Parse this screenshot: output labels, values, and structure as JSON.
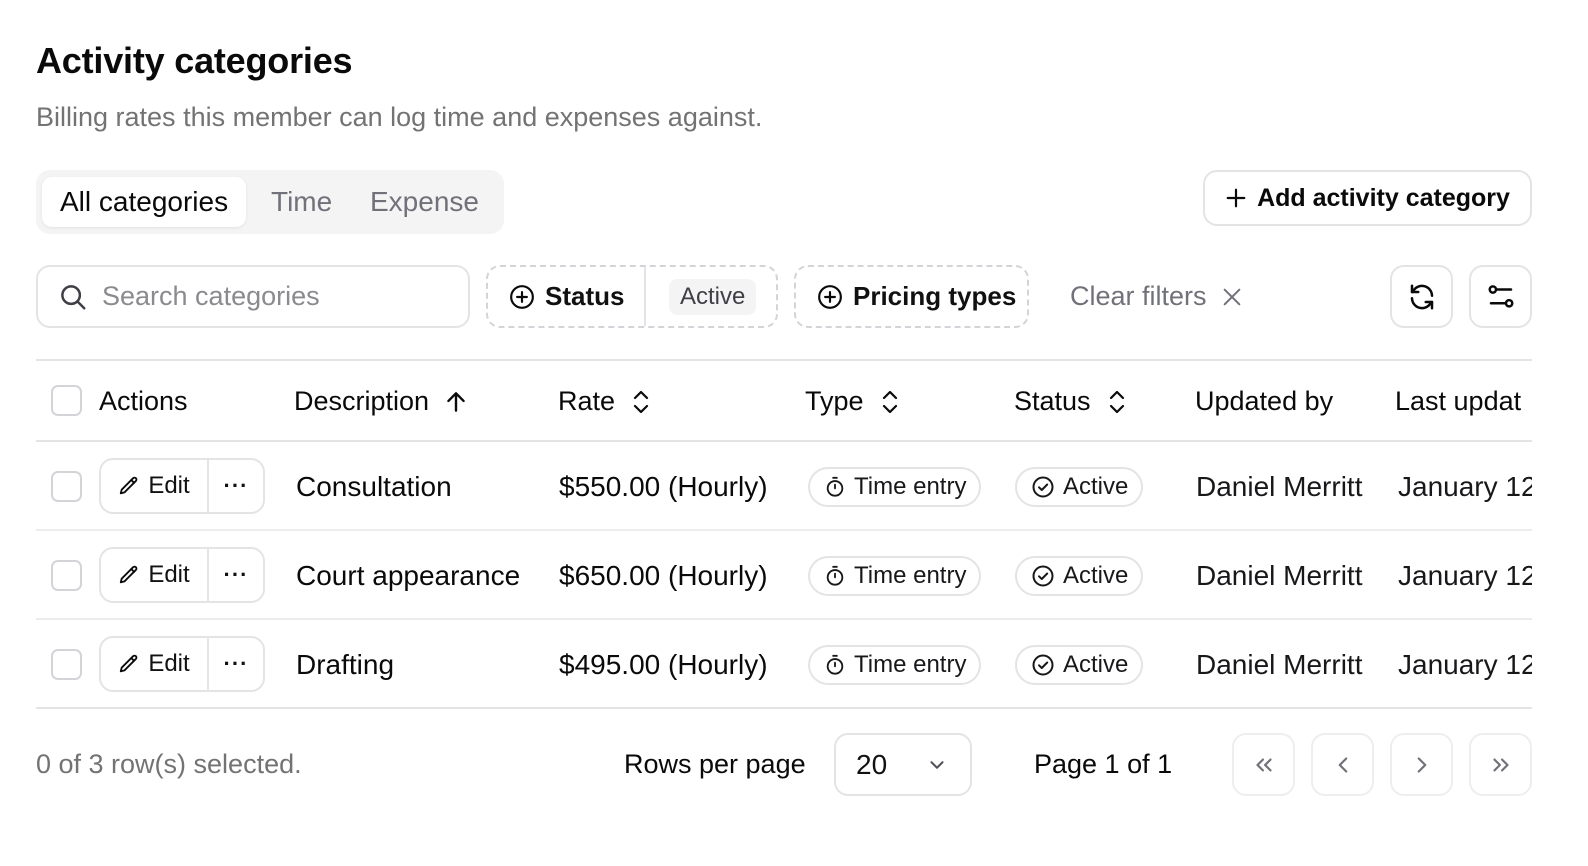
{
  "header": {
    "title": "Activity categories",
    "subtitle": "Billing rates this member can log time and expenses against."
  },
  "tabs": [
    {
      "label": "All categories",
      "active": true
    },
    {
      "label": "Time",
      "active": false
    },
    {
      "label": "Expense",
      "active": false
    }
  ],
  "add_button_label": "Add activity category",
  "toolbar": {
    "search_placeholder": "Search categories",
    "status_filter_label": "Status",
    "status_filter_value": "Active",
    "pricing_filter_label": "Pricing types",
    "clear_filters_label": "Clear filters"
  },
  "table": {
    "columns": [
      {
        "label": "Actions",
        "sort": "none"
      },
      {
        "label": "Description",
        "sort": "asc"
      },
      {
        "label": "Rate",
        "sort": "sortable"
      },
      {
        "label": "Type",
        "sort": "sortable"
      },
      {
        "label": "Status",
        "sort": "sortable"
      },
      {
        "label": "Updated by",
        "sort": "none"
      },
      {
        "label": "Last updat",
        "sort": "none"
      }
    ],
    "edit_label": "Edit",
    "more_label": "···",
    "rows": [
      {
        "description": "Consultation",
        "rate": "$550.00 (Hourly)",
        "type": "Time entry",
        "status": "Active",
        "updated_by": "Daniel Merritt",
        "last_updated": "January 12"
      },
      {
        "description": "Court appearance",
        "rate": "$650.00 (Hourly)",
        "type": "Time entry",
        "status": "Active",
        "updated_by": "Daniel Merritt",
        "last_updated": "January 12"
      },
      {
        "description": "Drafting",
        "rate": "$495.00 (Hourly)",
        "type": "Time entry",
        "status": "Active",
        "updated_by": "Daniel Merritt",
        "last_updated": "January 12"
      }
    ]
  },
  "footer": {
    "selection_text": "0 of 3 row(s) selected.",
    "rows_per_page_label": "Rows per page",
    "rows_per_page_value": "20",
    "page_text": "Page 1 of 1"
  }
}
